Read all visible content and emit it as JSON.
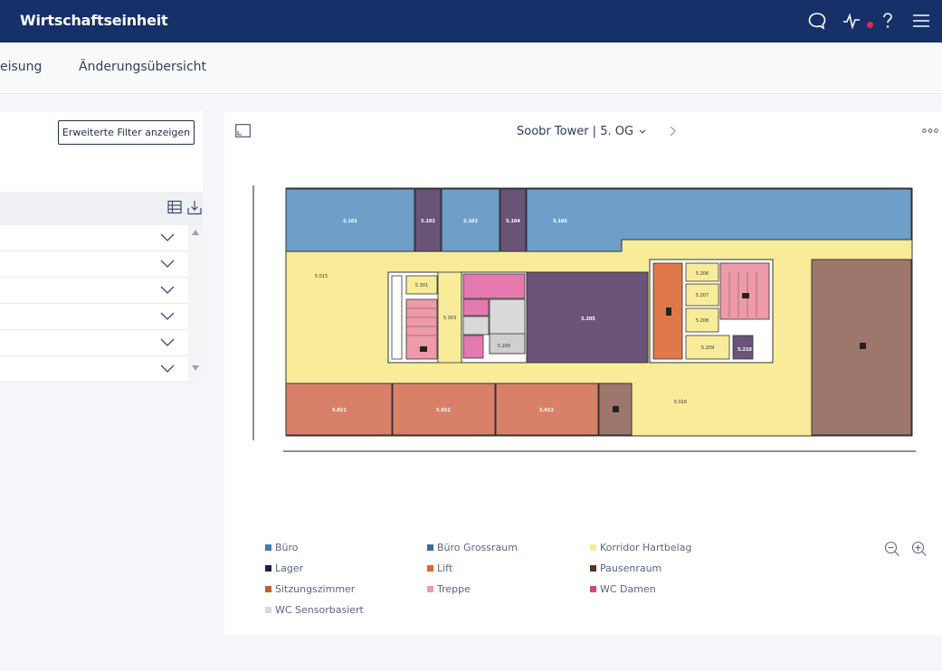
{
  "header": {
    "title": "Wirtschaftseinheit",
    "colors": {
      "bar": "#16306a",
      "notification_dot": "#e5274a"
    }
  },
  "tabs": [
    {
      "label": "eisung"
    },
    {
      "label": "Änderungsübersicht"
    }
  ],
  "left_panel": {
    "filter_button": "Erweiterte Filter anzeigen",
    "rows_count_visible": 6
  },
  "floorplan": {
    "title": "Soobr Tower | 5. OG",
    "rooms": [
      {
        "id": "5.101",
        "type": "Büro Grossraum"
      },
      {
        "id": "5.102",
        "type": "Lager"
      },
      {
        "id": "5.103",
        "type": "Büro Grossraum"
      },
      {
        "id": "5.104",
        "type": "Lager"
      },
      {
        "id": "5.105",
        "type": "Büro Grossraum"
      },
      {
        "id": "5.015",
        "type": "Korridor Hartbelag"
      },
      {
        "id": "5.301",
        "type": "Korridor Hartbelag"
      },
      {
        "id": "5.303",
        "type": "Korridor Hartbelag"
      },
      {
        "id": "5.200",
        "type": "WC Sensorbasiert"
      },
      {
        "id": "5.205",
        "type": "Lager"
      },
      {
        "id": "5.206",
        "type": "Korridor Hartbelag"
      },
      {
        "id": "5.207",
        "type": "Korridor Hartbelag"
      },
      {
        "id": "5.208",
        "type": "Korridor Hartbelag"
      },
      {
        "id": "5.209",
        "type": "Korridor Hartbelag"
      },
      {
        "id": "5.210",
        "type": "Lager"
      },
      {
        "id": "5.011",
        "type": "Sitzungszimmer"
      },
      {
        "id": "5.012",
        "type": "Sitzungszimmer"
      },
      {
        "id": "5.013",
        "type": "Sitzungszimmer"
      },
      {
        "id": "5.016",
        "type": "Korridor Hartbelag"
      }
    ]
  },
  "legend": [
    {
      "label": "Büro",
      "color": "#3f7fb5"
    },
    {
      "label": "Büro Grossraum",
      "color": "#3a6fa0"
    },
    {
      "label": "Korridor Hartbelag",
      "color": "#f8ec9a"
    },
    {
      "label": "Lager",
      "color": "#2a1a3f"
    },
    {
      "label": "Lift",
      "color": "#e0652a"
    },
    {
      "label": "Pausenraum",
      "color": "#5a3320"
    },
    {
      "label": "Sitzungszimmer",
      "color": "#c25a34"
    },
    {
      "label": "Treppe",
      "color": "#ee9aa8"
    },
    {
      "label": "WC Damen",
      "color": "#d4457c"
    },
    {
      "label": "WC Sensorbasiert",
      "color": "#d9d9d9"
    }
  ],
  "icons": [
    "chat-icon",
    "activity-icon",
    "help-icon",
    "menu-icon",
    "expand-icon",
    "chevron-down-icon",
    "chevron-right-icon",
    "more-icon",
    "table-icon",
    "download-icon",
    "zoom-out-icon",
    "zoom-in-icon"
  ]
}
